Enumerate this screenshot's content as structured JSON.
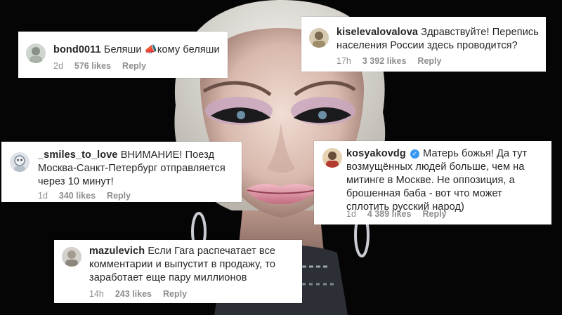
{
  "comments": [
    {
      "username": "bond0011",
      "text": "Беляши 📣кому беляши",
      "age": "2d",
      "likes": "576 likes",
      "reply": "Reply",
      "verified": false
    },
    {
      "username": "kiselevalovalova",
      "text": "Здравствуйте! Перепись населения России здесь проводится?",
      "age": "17h",
      "likes": "3 392 likes",
      "reply": "Reply",
      "verified": false
    },
    {
      "username": "_smiles_to_love",
      "text": "ВНИМАНИЕ! Поезд Москва-Санкт-Петербург отправляется через 10 минут!",
      "age": "1d",
      "likes": "340 likes",
      "reply": "Reply",
      "verified": false
    },
    {
      "username": "kosyakovdg",
      "text": "Матерь божья! Да тут возмущённых людей больше, чем на митинге в Москве. Не оппозиция, а брошенная баба - вот что может сплотить русский народ)",
      "age": "1d",
      "likes": "4 389 likes",
      "reply": "Reply",
      "verified": true,
      "verified_glyph": "✓"
    },
    {
      "username": "mazulevich",
      "text": "Если Гага распечатает все комментарии и выпустит в продажу, то заработает еще пару миллионов",
      "age": "14h",
      "likes": "243 likes",
      "reply": "Reply",
      "verified": false
    }
  ],
  "colors": {
    "card": "#ffffff",
    "text": "#262626",
    "meta": "#8e8e8e",
    "verified": "#3897f0",
    "background": "#050505"
  }
}
